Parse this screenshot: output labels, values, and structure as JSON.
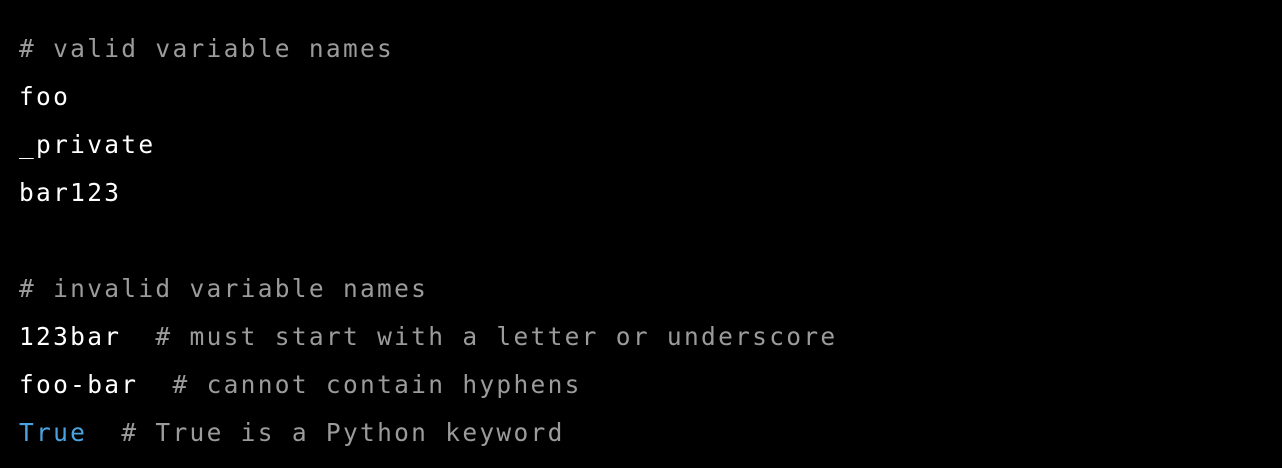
{
  "colors": {
    "background": "#000000",
    "code": "#ffffff",
    "comment": "#9b9b9b",
    "keyword": "#4aa3e0"
  },
  "lines": [
    {
      "type": "comment",
      "text": "# valid variable names"
    },
    {
      "type": "code",
      "text": "foo"
    },
    {
      "type": "code",
      "text": "_private"
    },
    {
      "type": "code",
      "text": "bar123"
    },
    {
      "type": "blank",
      "text": ""
    },
    {
      "type": "comment",
      "text": "# invalid variable names"
    },
    {
      "type": "code_with_comment",
      "code": "123bar",
      "spacer": "  ",
      "comment": "# must start with a letter or underscore"
    },
    {
      "type": "code_with_comment",
      "code": "foo-bar",
      "spacer": "  ",
      "comment": "# cannot contain hyphens"
    },
    {
      "type": "keyword_with_comment",
      "code": "True",
      "spacer": "  ",
      "comment": "# True is a Python keyword"
    }
  ]
}
